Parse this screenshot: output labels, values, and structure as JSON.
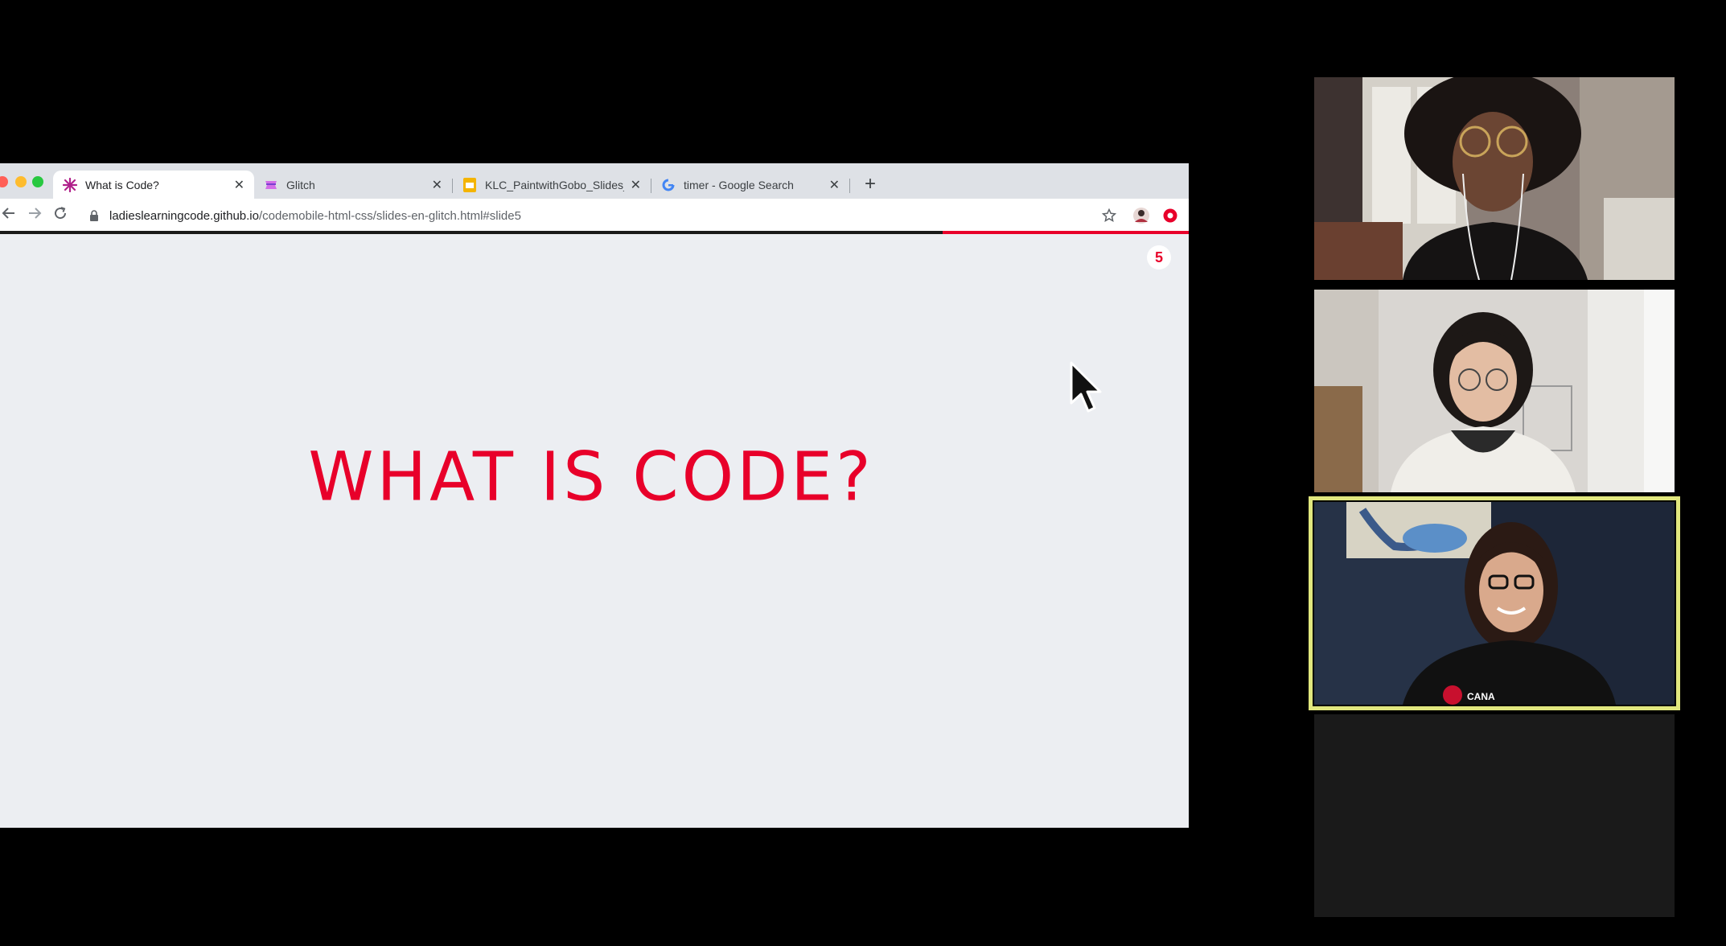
{
  "browser": {
    "tabs": [
      {
        "label": "What is Code?",
        "favicon": "ladies-learning-code-icon",
        "active": true
      },
      {
        "label": "Glitch",
        "favicon": "glitch-icon",
        "active": false
      },
      {
        "label": "KLC_PaintwithGobo_Slides_On",
        "favicon": "google-slides-icon",
        "active": false
      },
      {
        "label": "timer - Google Search",
        "favicon": "google-icon",
        "active": false
      }
    ],
    "tab_close": "✕",
    "new_tab": "+",
    "url": {
      "host": "ladieslearningcode.github.io",
      "path": "/codemobile-html-css/slides-en-glitch.html#slide5"
    },
    "progress_fraction": 0.207
  },
  "slide": {
    "title": "WHAT IS CODE?",
    "number": "5"
  },
  "colors": {
    "accent": "#e8002a",
    "slide_bg": "#eceef2",
    "speaker_highlight": "#e1e77e"
  },
  "participants": [
    {
      "tile": "participant-1",
      "speaking": false
    },
    {
      "tile": "participant-2",
      "speaking": false
    },
    {
      "tile": "participant-3",
      "speaking": true
    },
    {
      "tile": "participant-4-empty",
      "speaking": false
    }
  ]
}
